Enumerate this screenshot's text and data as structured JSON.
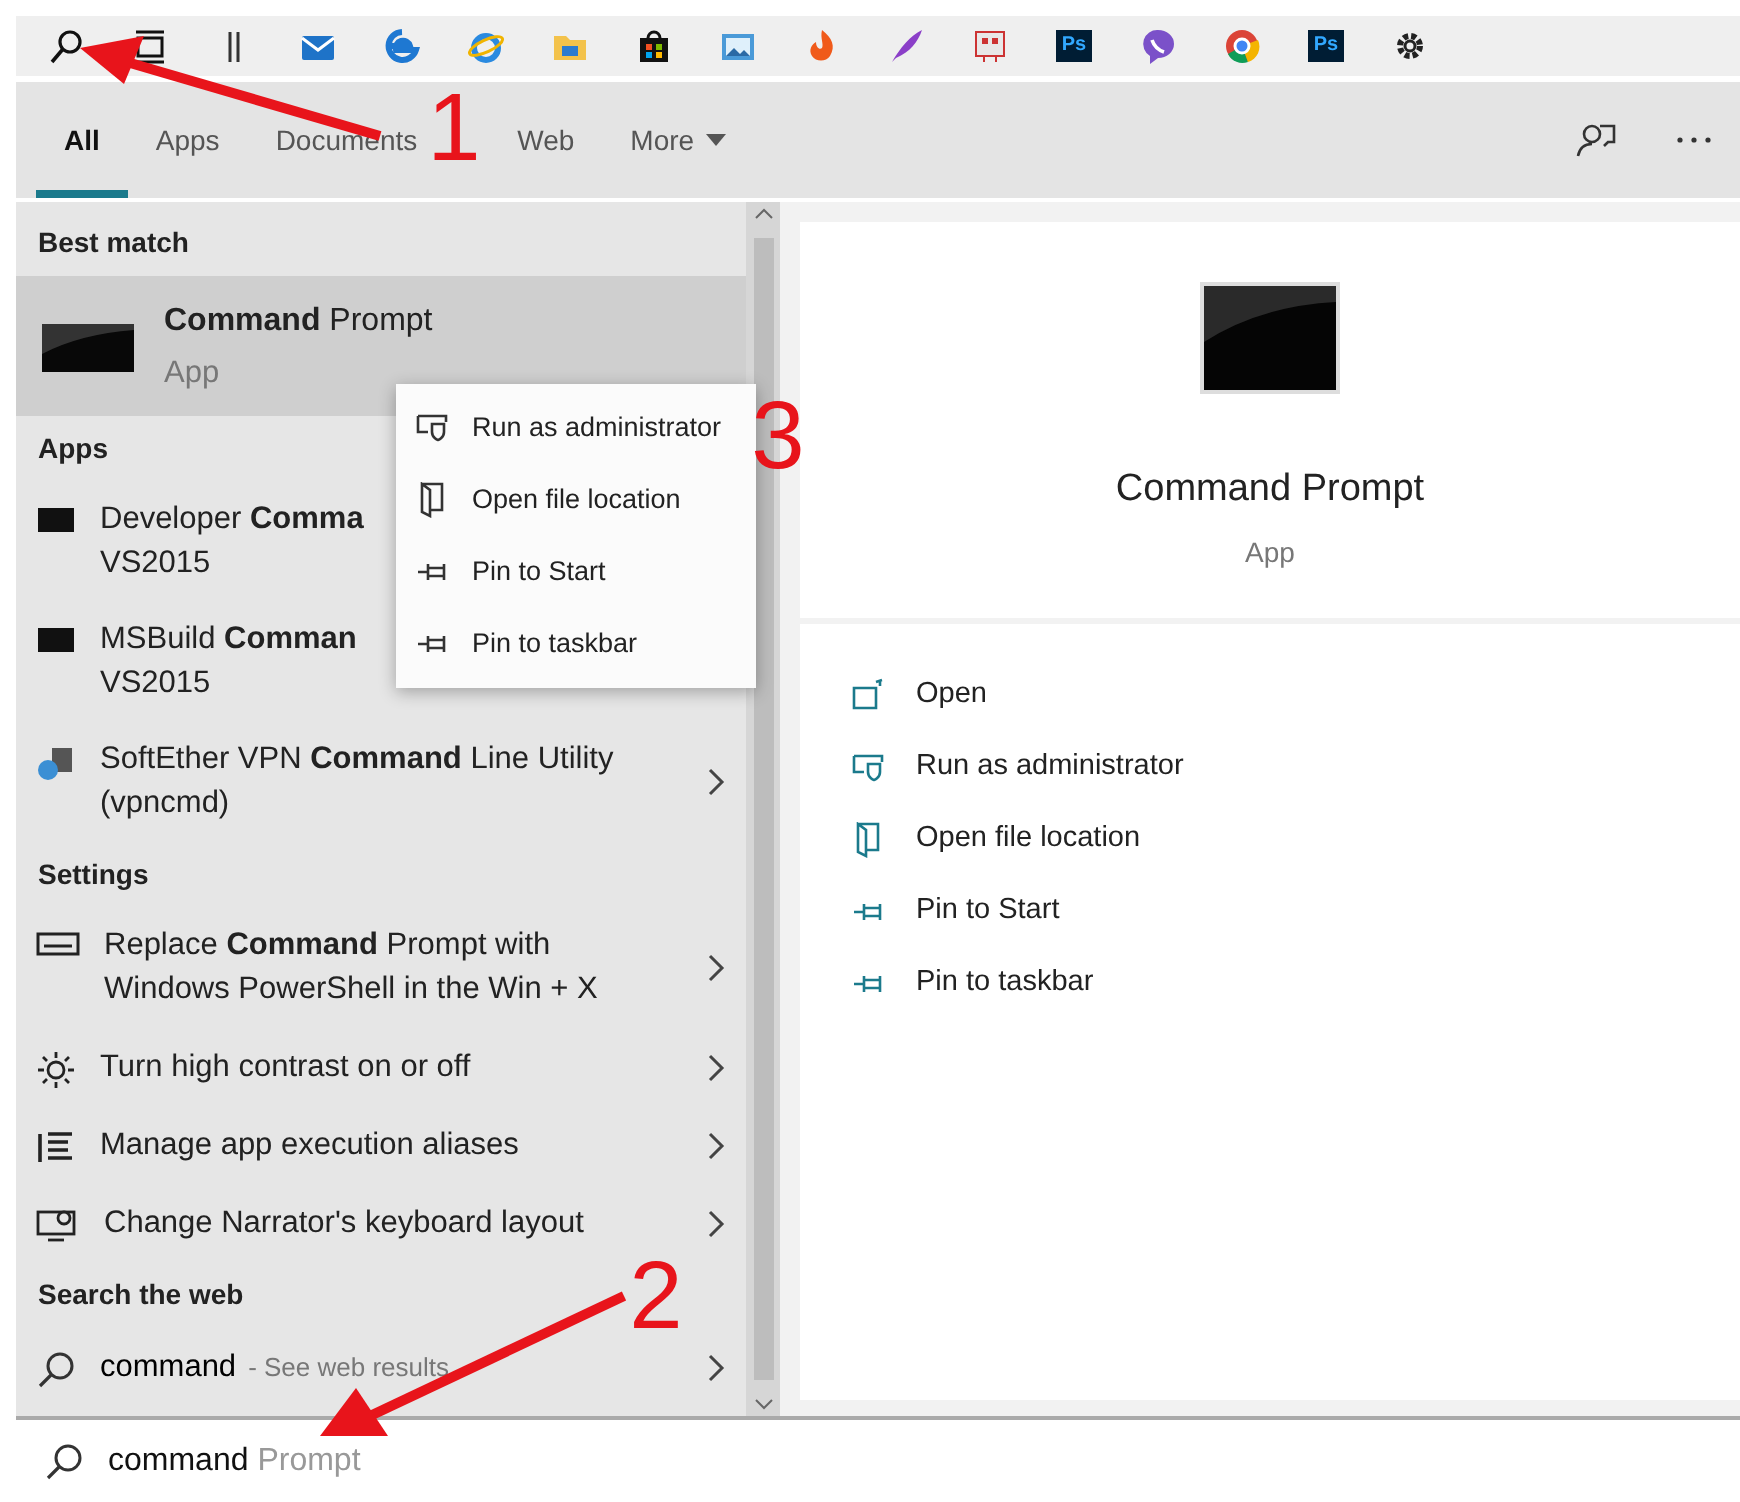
{
  "taskbar": [
    {
      "kind": "search"
    },
    {
      "kind": "taskview"
    },
    {
      "kind": "handle"
    },
    {
      "kind": "mail"
    },
    {
      "kind": "edge"
    },
    {
      "kind": "ie"
    },
    {
      "kind": "folder"
    },
    {
      "kind": "store"
    },
    {
      "kind": "photos"
    },
    {
      "kind": "flame"
    },
    {
      "kind": "feather"
    },
    {
      "kind": "app"
    },
    {
      "kind": "ps",
      "text": "Ps"
    },
    {
      "kind": "viber"
    },
    {
      "kind": "chrome"
    },
    {
      "kind": "ps",
      "text": "Ps"
    },
    {
      "kind": "gear"
    }
  ],
  "tabs": [
    {
      "label": "All",
      "selected": true,
      "caret": false
    },
    {
      "label": "Apps",
      "selected": false,
      "caret": false
    },
    {
      "label": "Documents",
      "selected": false,
      "caret": false
    },
    {
      "label": "Web",
      "selected": false,
      "caret": false
    },
    {
      "label": "More",
      "selected": false,
      "caret": true
    }
  ],
  "sections": [
    {
      "heading": "Best match",
      "items": [
        {
          "kind": "best",
          "title": "**Command** Prompt",
          "subtitle": "App",
          "selected": true
        }
      ]
    },
    {
      "heading": "Apps",
      "items": [
        {
          "kind": "app",
          "title": "Developer **Comma**",
          "subtitle": "VS2015",
          "selected": false
        },
        {
          "kind": "app",
          "title": "MSBuild **Comman**",
          "subtitle": "VS2015",
          "selected": false
        },
        {
          "kind": "app",
          "title": "SoftEther VPN **Command** Line Utility",
          "subtitle": "(vpncmd)",
          "selected": false
        }
      ]
    },
    {
      "heading": "Settings",
      "items": [
        {
          "kind": "setting",
          "title": "Replace **Command** Prompt with",
          "subtitle": "Windows PowerShell in the Win + X",
          "selected": false
        },
        {
          "kind": "setting",
          "title": "Turn high contrast on or off",
          "selected": false
        },
        {
          "kind": "setting",
          "title": "Manage app execution aliases",
          "selected": false
        },
        {
          "kind": "setting",
          "title": "Change Narrator's keyboard layout",
          "selected": false
        }
      ]
    },
    {
      "heading": "Search the web",
      "items": [
        {
          "kind": "web",
          "title": "command",
          "subtitle": "- See web results",
          "selected": false
        }
      ]
    }
  ],
  "context_menu": [
    {
      "label": "Run as administrator"
    },
    {
      "label": "Open file location"
    },
    {
      "label": "Pin to Start"
    },
    {
      "label": "Pin to taskbar"
    }
  ],
  "preview": {
    "title": "Command Prompt",
    "subtitle": "App",
    "actions": [
      {
        "label": "Open"
      },
      {
        "label": "Run as administrator"
      },
      {
        "label": "Open file location"
      },
      {
        "label": "Pin to Start"
      },
      {
        "label": "Pin to taskbar"
      }
    ]
  },
  "search": {
    "value": "command",
    "completion": "Prompt"
  },
  "annotations": [
    {
      "label": "1",
      "arrow": true
    },
    {
      "label": "2",
      "arrow": true
    },
    {
      "label": "3"
    }
  ]
}
